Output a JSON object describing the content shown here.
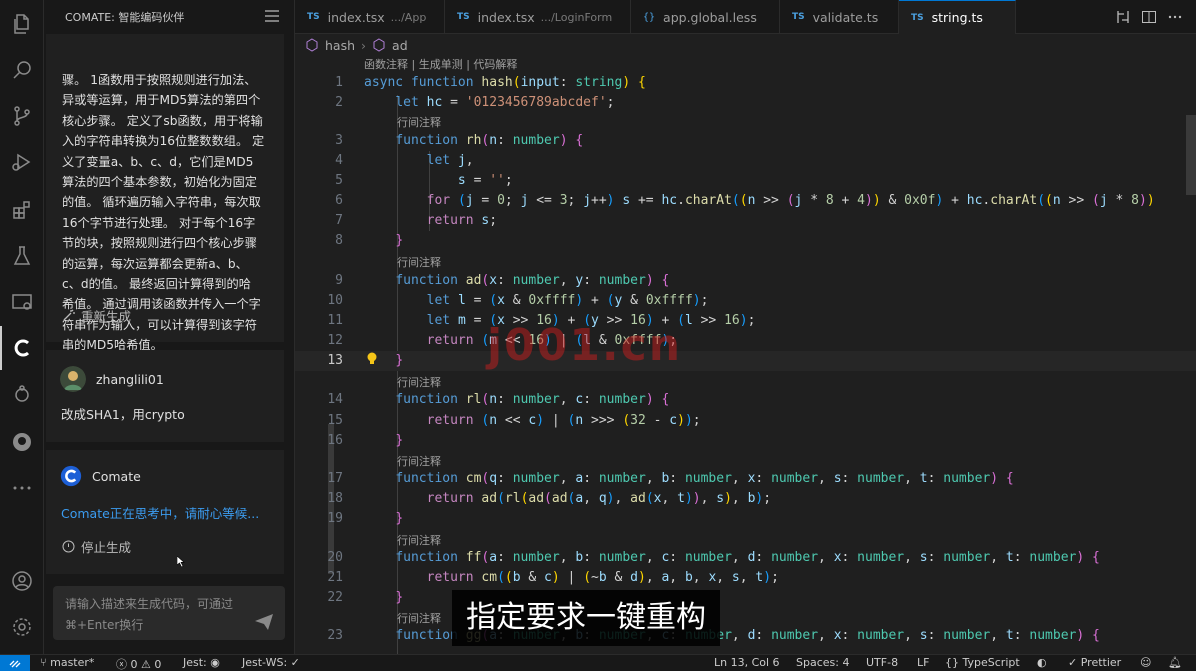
{
  "sidebar": {
    "title": "COMATE: 智能编码伙伴",
    "message_lines": [
      "骤。 1函数用于按照规则进行加法、",
      "异或等运算，用于MD5算法的第四个",
      "核心步骤。 定义了sb函数，用于将输",
      "入的字符串转换为16位整数数组。 定",
      "义了变量a、b、c、d，它们是MD5",
      "算法的四个基本参数，初始化为固定",
      "的值。 循环遍历输入字符串，每次取",
      "16个字节进行处理。 对于每个16字",
      "节的块，按照规则进行四个核心步骤",
      "的运算，每次运算都会更新a、b、",
      "c、d的值。 最终返回计算得到的哈",
      "希值。 通过调用该函数并传入一个字",
      "符串作为输入，可以计算得到该字符",
      "串的MD5哈希值。"
    ],
    "regenerate_label": "重新生成",
    "user_name": "zhanglili01",
    "user_message": "改成SHA1，用crypto",
    "bot_name": "Comate",
    "thinking_text": "Comate正在思考中，请耐心等候...",
    "stop_label": "停止生成",
    "input_placeholder_line1": "请输入描述来生成代码，可通过",
    "input_placeholder_line2": "⌘+Enter换行"
  },
  "tabs": [
    {
      "badge": "TS",
      "name": "index.tsx",
      "sub": ".../App"
    },
    {
      "badge": "TS",
      "name": "index.tsx",
      "sub": ".../LoginForm"
    },
    {
      "badge": "{}",
      "name": "app.global.less",
      "sub": ""
    },
    {
      "badge": "TS",
      "name": "validate.ts",
      "sub": ""
    },
    {
      "badge": "TS",
      "name": "string.ts",
      "sub": "",
      "active": true
    }
  ],
  "breadcrumb": {
    "first": "hash",
    "second": "ad"
  },
  "codelens": {
    "top": "函数注释 | 生成单测 | 代码解释",
    "inline": "行间注释"
  },
  "line_numbers": [
    "1",
    "2",
    "3",
    "4",
    "5",
    "6",
    "7",
    "8",
    "9",
    "10",
    "11",
    "12",
    "13",
    "14",
    "15",
    "16",
    "17",
    "18",
    "19",
    "20",
    "21",
    "22",
    "23"
  ],
  "watermark": "j001.cn",
  "caption": "指定要求一键重构",
  "status": {
    "branch": "master*",
    "errors": "0",
    "warnings": "0",
    "jest": "Jest:",
    "jest_ws": "Jest-WS: ✓",
    "position": "Ln 13, Col 6",
    "spaces": "Spaces: 4",
    "encoding": "UTF-8",
    "eol": "LF",
    "language": "TypeScript",
    "prettier": "Prettier"
  },
  "colors": {
    "accent": "#0078d4",
    "link": "#3b9cf0"
  }
}
